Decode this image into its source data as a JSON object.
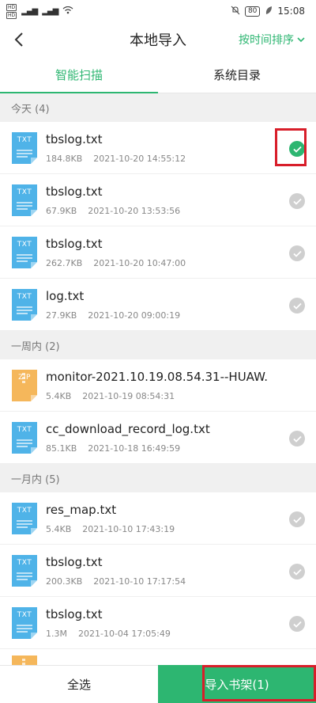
{
  "status_bar": {
    "time": "15:08",
    "battery": "80",
    "hd1": "HD",
    "hd2": "HD",
    "signal": "4G"
  },
  "header": {
    "title": "本地导入",
    "sort_label": "按时间排序"
  },
  "tabs": [
    {
      "label": "智能扫描",
      "active": true
    },
    {
      "label": "系统目录",
      "active": false
    }
  ],
  "sections": [
    {
      "label": "今天 (4)",
      "files": [
        {
          "name": "tbslog.txt",
          "size": "184.8KB",
          "date": "2021-10-20 14:55:12",
          "type": "TXT",
          "checked": true,
          "highlighted": true
        },
        {
          "name": "tbslog.txt",
          "size": "67.9KB",
          "date": "2021-10-20 13:53:56",
          "type": "TXT",
          "checked": false
        },
        {
          "name": "tbslog.txt",
          "size": "262.7KB",
          "date": "2021-10-20 10:47:00",
          "type": "TXT",
          "checked": false
        },
        {
          "name": "log.txt",
          "size": "27.9KB",
          "date": "2021-10-20 09:00:19",
          "type": "TXT",
          "checked": false
        }
      ]
    },
    {
      "label": "一周内 (2)",
      "files": [
        {
          "name": "monitor-2021.10.19.08.54.31--HUAW...",
          "size": "5.4KB",
          "date": "2021-10-19 08:54:31",
          "type": "ZIP",
          "checked": null
        },
        {
          "name": "cc_download_record_log.txt",
          "size": "85.1KB",
          "date": "2021-10-18 16:49:59",
          "type": "TXT",
          "checked": false
        }
      ]
    },
    {
      "label": "一月内 (5)",
      "files": [
        {
          "name": "res_map.txt",
          "size": "5.4KB",
          "date": "2021-10-10 17:43:19",
          "type": "TXT",
          "checked": false
        },
        {
          "name": "tbslog.txt",
          "size": "200.3KB",
          "date": "2021-10-10 17:17:54",
          "type": "TXT",
          "checked": false
        },
        {
          "name": "tbslog.txt",
          "size": "1.3M",
          "date": "2021-10-04 17:05:49",
          "type": "TXT",
          "checked": false
        }
      ]
    }
  ],
  "bottom": {
    "select_all": "全选",
    "import": "导入书架(1)"
  },
  "colors": {
    "accent": "#2db671",
    "highlight": "#d81e2a",
    "txt_icon": "#4fb3e8",
    "zip_icon": "#f5b75b"
  }
}
